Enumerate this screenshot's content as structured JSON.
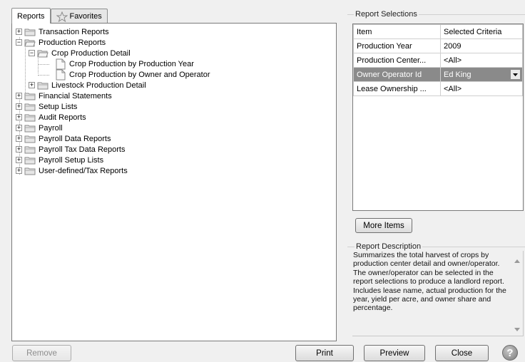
{
  "tabs": [
    {
      "label": "Reports",
      "active": true
    },
    {
      "label": "Favorites",
      "icon": "star-icon",
      "active": false
    }
  ],
  "tree": [
    {
      "label": "Transaction Reports",
      "expander": "+",
      "icon": "folder-icon"
    },
    {
      "label": "Production Reports",
      "expander": "−",
      "icon": "folder-open-icon"
    },
    {
      "label": "Crop Production Detail",
      "expander": "−",
      "icon": "folder-open-icon"
    },
    {
      "label": "Crop Production by Production Year",
      "expander": "",
      "icon": "document-icon"
    },
    {
      "label": "Crop Production by Owner and Operator",
      "expander": "",
      "icon": "document-icon"
    },
    {
      "label": "Livestock Production Detail",
      "expander": "+",
      "icon": "folder-icon"
    },
    {
      "label": "Financial Statements",
      "expander": "+",
      "icon": "folder-icon"
    },
    {
      "label": "Setup Lists",
      "expander": "+",
      "icon": "folder-icon"
    },
    {
      "label": "Audit Reports",
      "expander": "+",
      "icon": "folder-icon"
    },
    {
      "label": "Payroll",
      "expander": "+",
      "icon": "folder-icon"
    },
    {
      "label": "Payroll Data Reports",
      "expander": "+",
      "icon": "folder-icon"
    },
    {
      "label": "Payroll Tax Data Reports",
      "expander": "+",
      "icon": "folder-icon"
    },
    {
      "label": "Payroll Setup Lists",
      "expander": "+",
      "icon": "folder-icon"
    },
    {
      "label": "User-defined/Tax Reports",
      "expander": "+",
      "icon": "folder-icon"
    }
  ],
  "report_selections": {
    "group_label": "Report Selections",
    "columns": [
      "Item",
      "Selected Criteria"
    ],
    "rows": [
      {
        "item": "Production Year",
        "criteria": "2009",
        "selected": false
      },
      {
        "item": "Production Center...",
        "criteria": "<All>",
        "selected": false
      },
      {
        "item": "Owner Operator Id",
        "criteria": "Ed King",
        "selected": true
      },
      {
        "item": "Lease Ownership ...",
        "criteria": "<All>",
        "selected": false
      }
    ],
    "more_items_label": "More Items"
  },
  "report_description": {
    "group_label": "Report Description",
    "text": "Summarizes the total harvest of crops by production center detail and owner/operator. The owner/operator can be selected in the report selections to produce a landlord report. Includes lease name, actual production for the year, yield per acre, and owner share and percentage."
  },
  "buttons": {
    "remove": "Remove",
    "print": "Print",
    "preview": "Preview",
    "close": "Close",
    "help": "?"
  },
  "colors": {
    "selected_row": "#8a8a8a",
    "window_bg": "#f0f0f0",
    "folder": "#d8d8d8"
  }
}
